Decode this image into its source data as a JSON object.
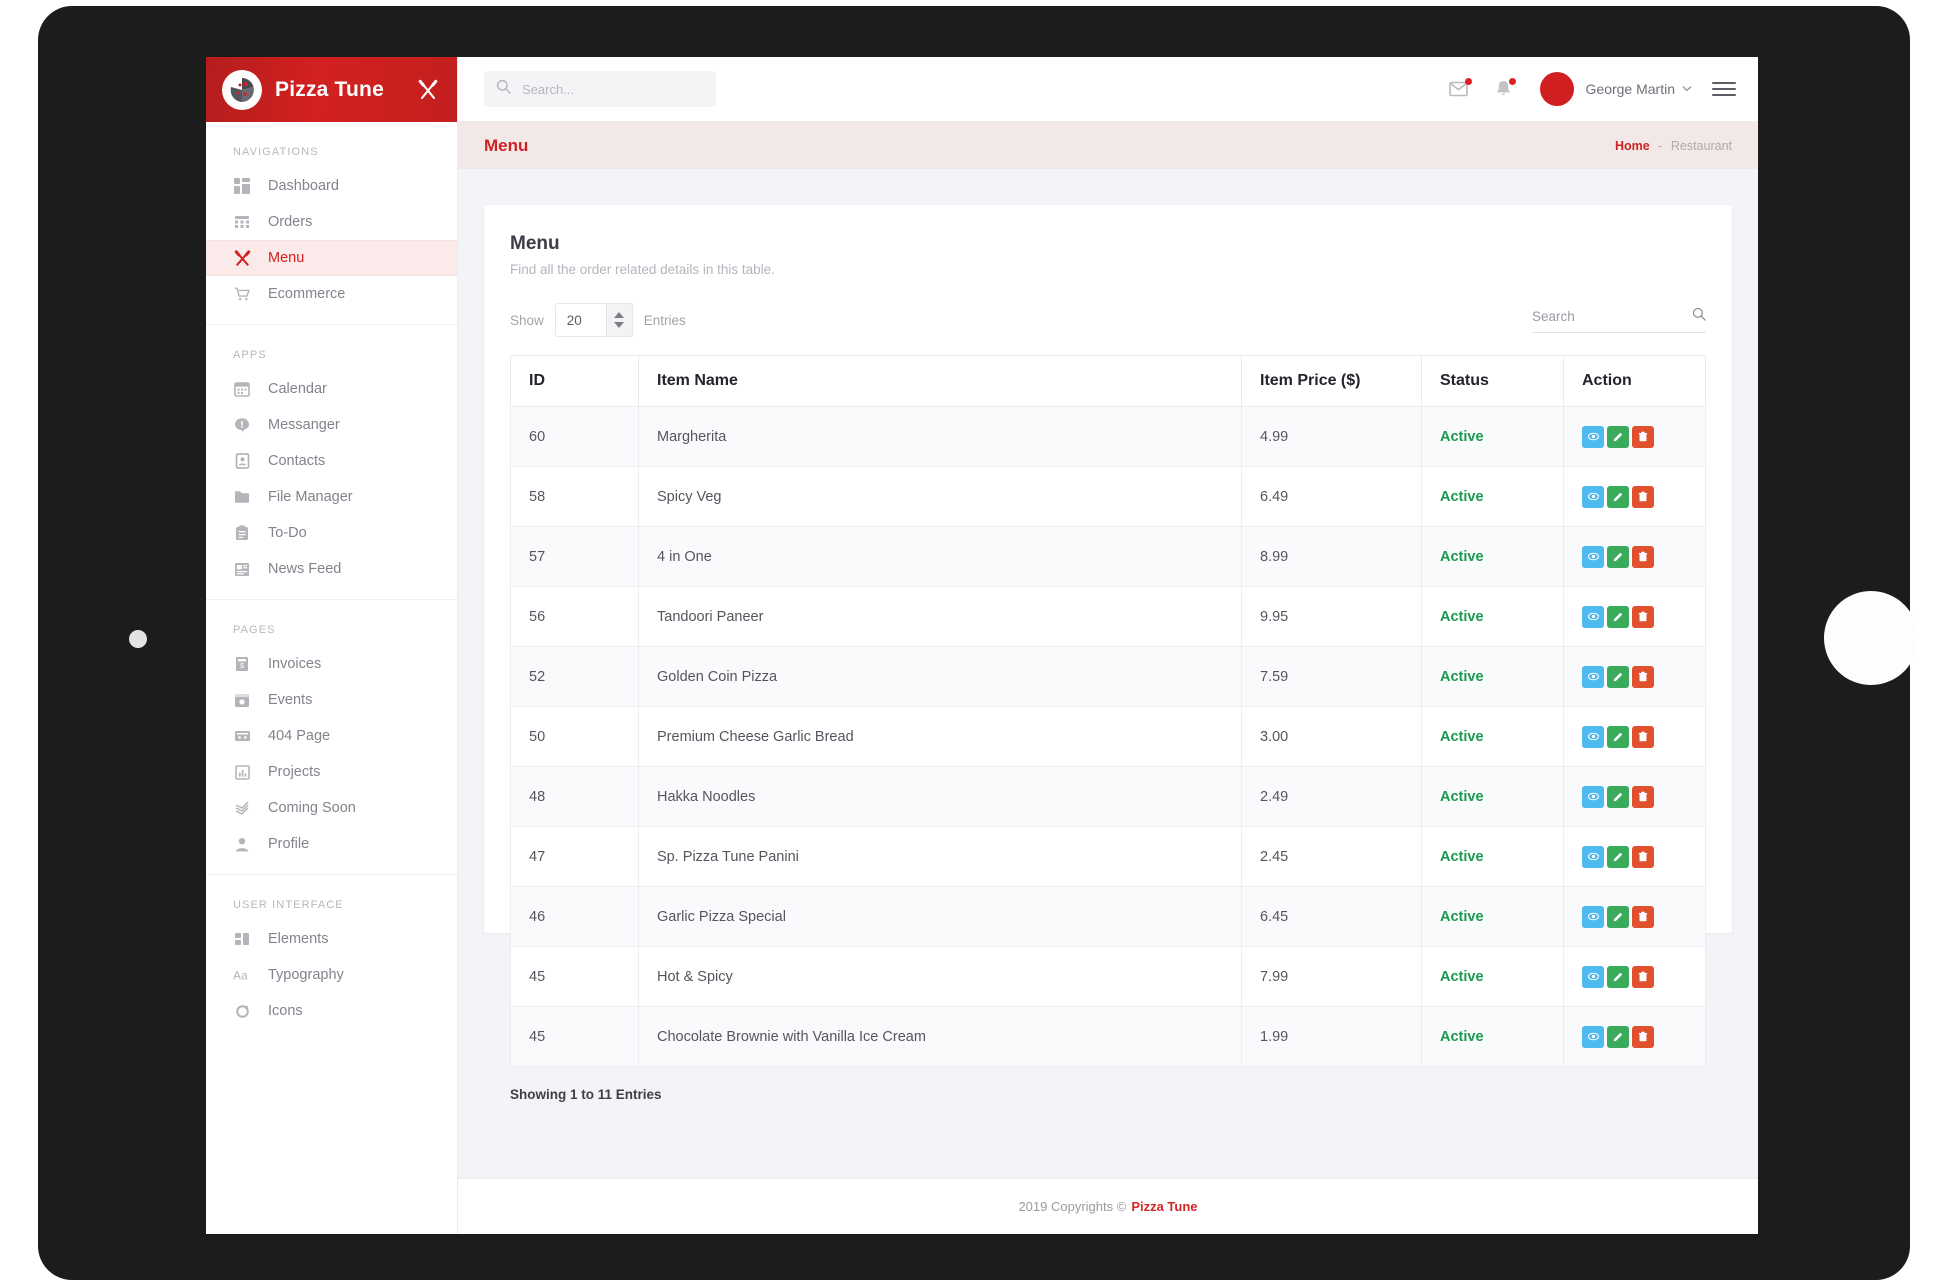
{
  "brand": {
    "name": "Pizza Tune",
    "logo_icon": "pizza-slice-icon",
    "toggle_icon": "crossed-utensils-icon"
  },
  "topbar": {
    "search_placeholder": "Search...",
    "search_value": "",
    "search_icon": "search-icon",
    "mail_icon": "envelope-icon",
    "notification_icon": "bell-icon",
    "user_name": "George Martin",
    "caret_icon": "chevron-down-icon",
    "menu_icon": "hamburger-icon",
    "accent_color": "#d32020",
    "badge_color": "#e02020"
  },
  "pagebar": {
    "title": "Menu",
    "breadcrumb_home": "Home",
    "breadcrumb_sep": "-",
    "breadcrumb_current": "Restaurant"
  },
  "sidebar": {
    "groups": [
      {
        "title": "NAVIGATIONS",
        "items": [
          {
            "label": "Dashboard",
            "icon": "dashboard-grid-icon",
            "active": false
          },
          {
            "label": "Orders",
            "icon": "orders-table-icon",
            "active": false
          },
          {
            "label": "Menu",
            "icon": "crossed-utensils-icon",
            "active": true
          },
          {
            "label": "Ecommerce",
            "icon": "shopping-cart-icon",
            "active": false
          }
        ]
      },
      {
        "title": "APPS",
        "items": [
          {
            "label": "Calendar",
            "icon": "calendar-icon",
            "active": false
          },
          {
            "label": "Messanger",
            "icon": "chat-bubble-icon",
            "active": false
          },
          {
            "label": "Contacts",
            "icon": "contact-card-icon",
            "active": false
          },
          {
            "label": "File Manager",
            "icon": "folder-icon",
            "active": false
          },
          {
            "label": "To-Do",
            "icon": "clipboard-icon",
            "active": false
          },
          {
            "label": "News Feed",
            "icon": "newspaper-icon",
            "active": false
          }
        ]
      },
      {
        "title": "PAGES",
        "items": [
          {
            "label": "Invoices",
            "icon": "invoice-icon",
            "active": false
          },
          {
            "label": "Events",
            "icon": "events-window-icon",
            "active": false
          },
          {
            "label": "404 Page",
            "icon": "broken-page-icon",
            "active": false
          },
          {
            "label": "Projects",
            "icon": "bar-chart-icon",
            "active": false
          },
          {
            "label": "Coming Soon",
            "icon": "layers-icon",
            "active": false
          },
          {
            "label": "Profile",
            "icon": "user-icon",
            "active": false
          }
        ]
      },
      {
        "title": "USER INTERFACE",
        "items": [
          {
            "label": "Elements",
            "icon": "elements-blocks-icon",
            "active": false
          },
          {
            "label": "Typography",
            "icon": "typography-aa-icon",
            "active": false
          },
          {
            "label": "Icons",
            "icon": "circle-icon",
            "active": false
          }
        ]
      }
    ]
  },
  "card": {
    "title": "Menu",
    "subtitle": "Find all the order related details in this table.",
    "show_label": "Show",
    "entries_label": "Entries",
    "entries_value": "20",
    "search_placeholder": "Search",
    "search_value": "",
    "search_icon": "search-icon",
    "showing_text": "Showing 1 to 11 Entries"
  },
  "table": {
    "columns": [
      "ID",
      "Item Name",
      "Item Price ($)",
      "Status",
      "Action"
    ],
    "action_icons": [
      "eye-icon",
      "pencil-icon",
      "trash-icon"
    ],
    "action_colors": {
      "view": "#4dbaf0",
      "edit": "#3aab5b",
      "delete": "#e2512e"
    },
    "status_color": "#1a9a4e",
    "rows": [
      {
        "id": "60",
        "name": "Margherita",
        "price": "4.99",
        "status": "Active"
      },
      {
        "id": "58",
        "name": "Spicy Veg",
        "price": "6.49",
        "status": "Active"
      },
      {
        "id": "57",
        "name": "4 in One",
        "price": "8.99",
        "status": "Active"
      },
      {
        "id": "56",
        "name": "Tandoori Paneer",
        "price": "9.95",
        "status": "Active"
      },
      {
        "id": "52",
        "name": "Golden Coin Pizza",
        "price": "7.59",
        "status": "Active"
      },
      {
        "id": "50",
        "name": "Premium Cheese Garlic Bread",
        "price": "3.00",
        "status": "Active"
      },
      {
        "id": "48",
        "name": "Hakka Noodles",
        "price": "2.49",
        "status": "Active"
      },
      {
        "id": "47",
        "name": "Sp. Pizza Tune Panini",
        "price": "2.45",
        "status": "Active"
      },
      {
        "id": "46",
        "name": "Garlic Pizza Special",
        "price": "6.45",
        "status": "Active"
      },
      {
        "id": "45",
        "name": "Hot & Spicy",
        "price": "7.99",
        "status": "Active"
      },
      {
        "id": "45",
        "name": "Chocolate Brownie with Vanilla Ice Cream",
        "price": "1.99",
        "status": "Active"
      }
    ]
  },
  "footer": {
    "text": "2019 Copyrights ©",
    "brand": "Pizza Tune"
  }
}
